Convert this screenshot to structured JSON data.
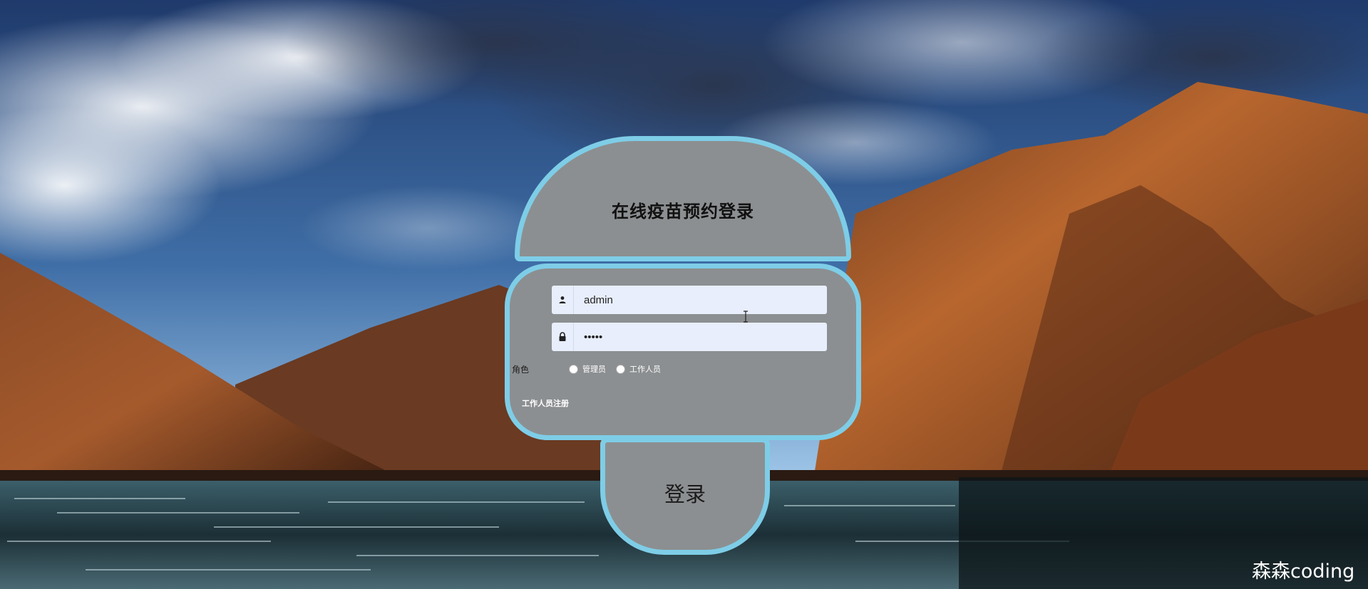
{
  "login": {
    "title": "在线疫苗预约登录",
    "username_value": "admin",
    "password_value": "•••••",
    "role_label": "角色",
    "roles": [
      "管理员",
      "工作人员"
    ],
    "register_link": "工作人员注册",
    "submit_label": "登录"
  },
  "watermark": "森森coding",
  "colors": {
    "card_bg": "#8c8f91",
    "card_border": "#7ecde7",
    "input_bg": "#e8eefc"
  },
  "icons": {
    "username": "user-icon",
    "password": "lock-icon",
    "cursor": "text-cursor-icon"
  }
}
